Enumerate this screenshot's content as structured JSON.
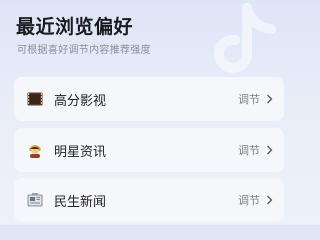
{
  "header": {
    "title": "最近浏览偏好",
    "subtitle": "可根据喜好调节内容推荐强度"
  },
  "categories": [
    {
      "label": "高分影视",
      "action": "调节",
      "icon": "film-strip-icon"
    },
    {
      "label": "明星资讯",
      "action": "调节",
      "icon": "star-person-icon"
    },
    {
      "label": "民生新闻",
      "action": "调节",
      "icon": "newspaper-icon"
    }
  ],
  "colors": {
    "background": "#dde5f7",
    "card": "#f6f7fb",
    "title": "#1b1b1f",
    "muted": "#8a8d96"
  }
}
